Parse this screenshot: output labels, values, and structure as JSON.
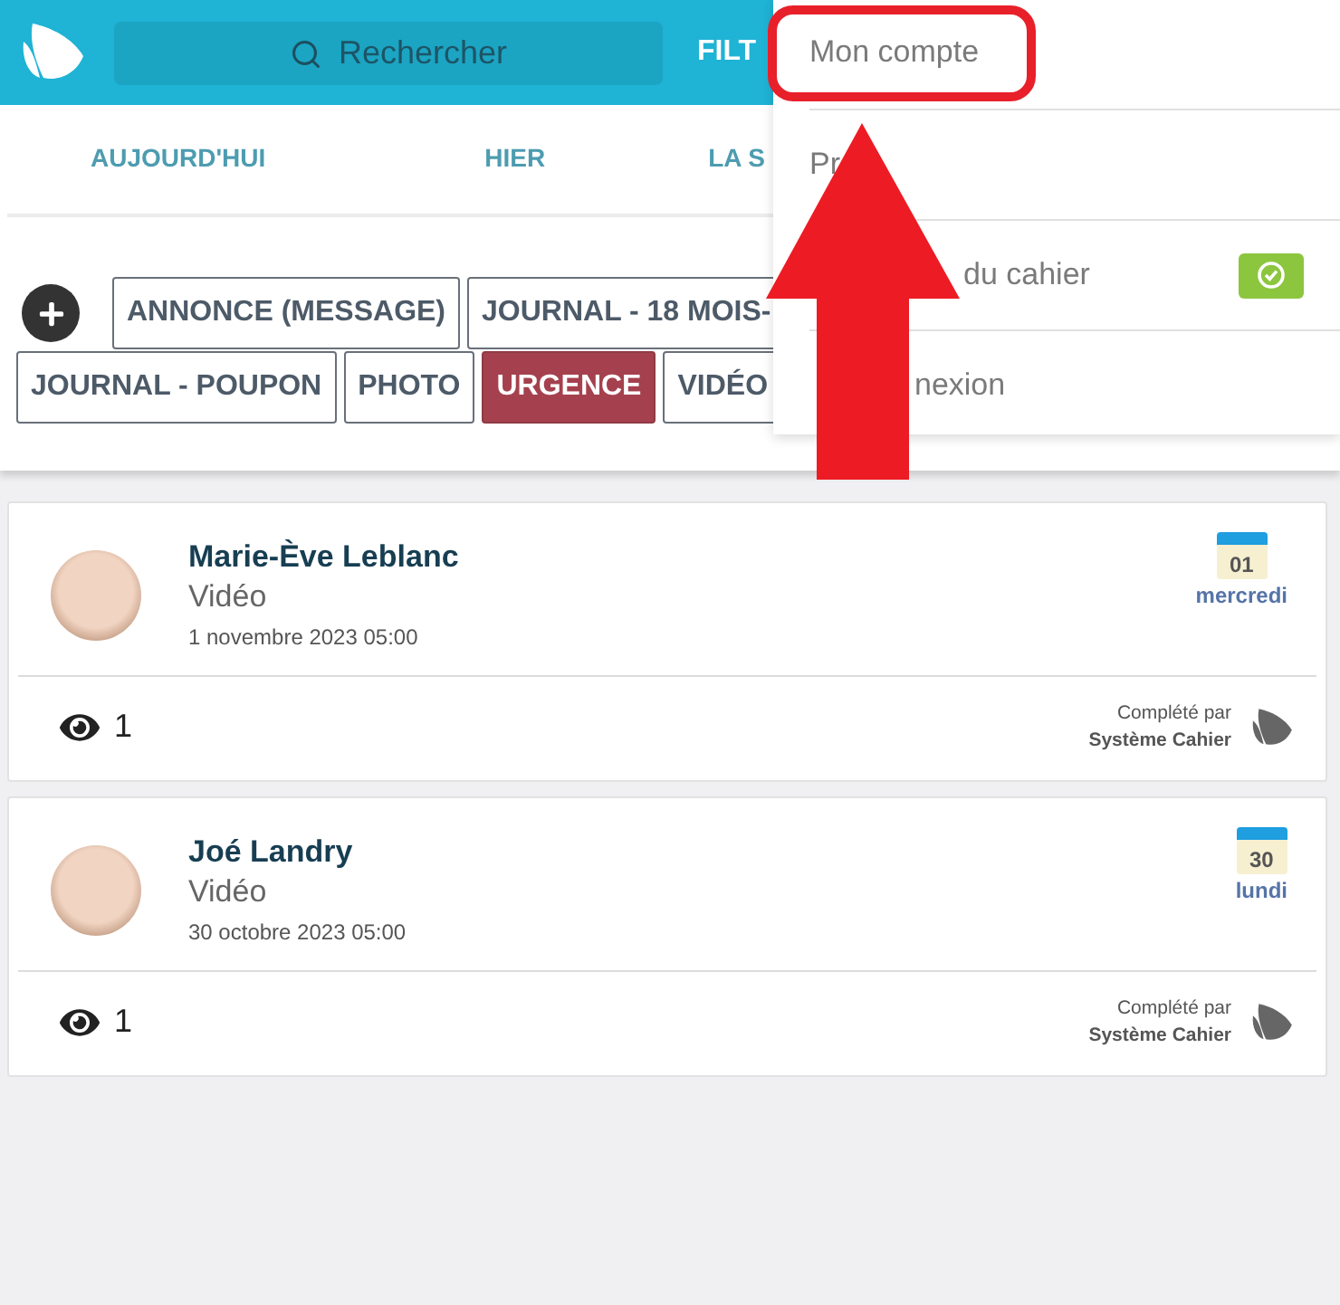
{
  "header": {
    "search": {
      "placeholder": "Rechercher"
    },
    "filter_label": "FILT"
  },
  "date_tabs": [
    {
      "label": "AUJOURD'HUI",
      "selected": false
    },
    {
      "label": "HIER",
      "selected": false
    },
    {
      "label": "LA S",
      "selected": false
    }
  ],
  "tags": [
    {
      "label": "ANNONCE (MESSAGE)",
      "selected": false
    },
    {
      "label": "JOURNAL - 18 MOIS-",
      "selected": false
    },
    {
      "label": "JOURNAL - POUPON",
      "selected": false
    },
    {
      "label": "PHOTO",
      "selected": false
    },
    {
      "label": "URGENCE",
      "selected": true
    },
    {
      "label": "VIDÉO",
      "selected": false
    }
  ],
  "posts": [
    {
      "name": "Marie-Ève Leblanc",
      "type": "Vidéo",
      "date": "1 novembre 2023 05:00",
      "day_number": "01",
      "weekday": "mercredi",
      "views": "1",
      "completed_label": "Complété par",
      "completed_by": "Système Cahier"
    },
    {
      "name": "Joé Landry",
      "type": "Vidéo",
      "date": "30 octobre 2023 05:00",
      "day_number": "30",
      "weekday": "lundi",
      "views": "1",
      "completed_label": "Complété par",
      "completed_by": "Système Cahier"
    }
  ],
  "account_menu": {
    "items": [
      {
        "label": "Mon compte",
        "kind": "link",
        "highlighted": true
      },
      {
        "label": "Pr",
        "kind": "link",
        "highlighted": false
      },
      {
        "label": "du cahier",
        "kind": "toggle",
        "on": true,
        "highlighted": false
      },
      {
        "label": "nexion",
        "kind": "link",
        "highlighted": false
      }
    ]
  }
}
